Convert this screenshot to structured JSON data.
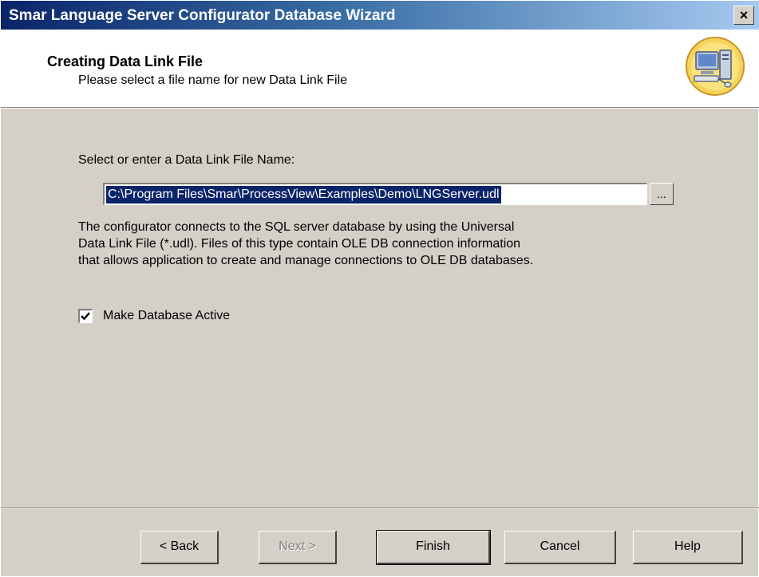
{
  "window": {
    "title": "Smar Language Server Configurator Database Wizard",
    "close_label": "×"
  },
  "header": {
    "title": "Creating Data Link File",
    "subtitle": "Please select a file name for new Data Link File",
    "logo_icon": "computer-wizard-icon"
  },
  "form": {
    "file_label": "Select or enter a Data Link File Name:",
    "file_value": "C:\\Program Files\\Smar\\ProcessView\\Examples\\Demo\\LNGServer.udl",
    "browse_label": "...",
    "description_lines": [
      "The configurator connects to the SQL server database by using the Universal",
      "Data Link File (*.udl). Files of this type contain OLE DB connection information",
      "that allows application to create and manage connections to OLE DB databases."
    ],
    "checkbox_label": "Make Database Active",
    "checkbox_checked": true
  },
  "buttons": {
    "back": "< Back",
    "next": "Next >",
    "finish": "Finish",
    "cancel": "Cancel",
    "help": "Help"
  },
  "colors": {
    "titlebar_start": "#0a246a",
    "titlebar_end": "#a6caf0",
    "selection": "#0a246a",
    "dialog_bg": "#d4d0c8"
  }
}
